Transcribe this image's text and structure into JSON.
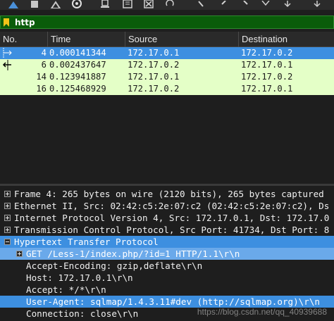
{
  "toolbar": {
    "icons": [
      "shark-fin-icon",
      "stop-icon",
      "restart-icon",
      "options-icon",
      "open-icon",
      "save-icon",
      "close-file-icon",
      "reload-icon",
      "find-icon",
      "back-icon",
      "forward-icon",
      "go-to-icon"
    ]
  },
  "filter": {
    "value": "http",
    "bg_color": "#0a5c0a"
  },
  "packet_list": {
    "columns": [
      "No.",
      "Time",
      "Source",
      "Destination"
    ],
    "rows": [
      {
        "no": "4",
        "time": "0.000141344",
        "source": "172.17.0.1",
        "destination": "172.17.0.2",
        "selected": true
      },
      {
        "no": "6",
        "time": "0.002437647",
        "source": "172.17.0.2",
        "destination": "172.17.0.1",
        "selected": false
      },
      {
        "no": "14",
        "time": "0.123941887",
        "source": "172.17.0.1",
        "destination": "172.17.0.2",
        "selected": false
      },
      {
        "no": "16",
        "time": "0.125468929",
        "source": "172.17.0.2",
        "destination": "172.17.0.1",
        "selected": false
      }
    ],
    "selected_color": "#3d8fe0",
    "http_row_color": "#e4ffc7"
  },
  "details": {
    "lines": [
      {
        "text": "Frame 4: 265 bytes on wire (2120 bits), 265 bytes captured",
        "expander": "plus"
      },
      {
        "text": "Ethernet II, Src: 02:42:c5:2e:07:c2 (02:42:c5:2e:07:c2), Ds",
        "expander": "plus"
      },
      {
        "text": "Internet Protocol Version 4, Src: 172.17.0.1, Dst: 172.17.0",
        "expander": "plus"
      },
      {
        "text": "Transmission Control Protocol, Src Port: 41734, Dst Port: 8",
        "expander": "plus"
      },
      {
        "text": "Hypertext Transfer Protocol",
        "expander": "minus"
      },
      {
        "text": "GET /Less-1/index.php/?id=1 HTTP/1.1\\r\\n",
        "expander": "plus"
      },
      {
        "text": "Accept-Encoding: gzip,deflate\\r\\n",
        "expander": ""
      },
      {
        "text": "Host: 172.17.0.1\\r\\n",
        "expander": ""
      },
      {
        "text": "Accept: */*\\r\\n",
        "expander": ""
      },
      {
        "text": "User-Agent: sqlmap/1.4.3.11#dev (http://sqlmap.org)\\r\\n",
        "expander": ""
      },
      {
        "text": "Connection: close\\r\\n",
        "expander": ""
      }
    ]
  },
  "watermark": "https://blog.csdn.net/qq_40939688"
}
